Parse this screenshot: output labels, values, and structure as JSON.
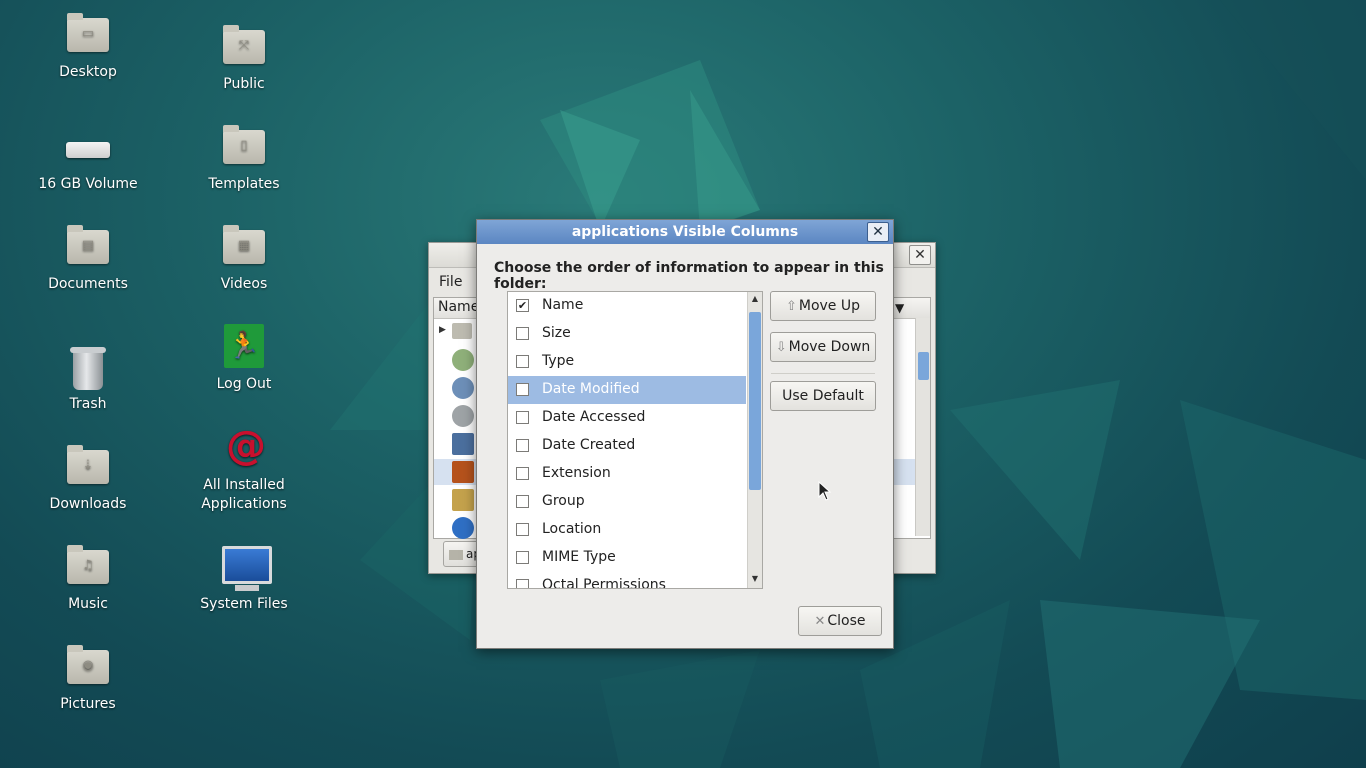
{
  "desktop": {
    "icons": [
      {
        "label": "Desktop",
        "icon": "folder-desktop-icon"
      },
      {
        "label": "Public",
        "icon": "folder-public-icon"
      },
      {
        "label": "16 GB Volume",
        "icon": "drive-icon"
      },
      {
        "label": "Templates",
        "icon": "folder-templates-icon"
      },
      {
        "label": "Documents",
        "icon": "folder-documents-icon"
      },
      {
        "label": "Videos",
        "icon": "folder-videos-icon"
      },
      {
        "label": "Trash",
        "icon": "trash-icon"
      },
      {
        "label": "Log Out",
        "icon": "log-out-icon"
      },
      {
        "label": "Downloads",
        "icon": "folder-downloads-icon"
      },
      {
        "label": "All Installed Applications",
        "icon": "debian-swirl-icon"
      },
      {
        "label": "Music",
        "icon": "folder-music-icon"
      },
      {
        "label": "System Files",
        "icon": "monitor-icon"
      },
      {
        "label": "Pictures",
        "icon": "folder-pictures-icon"
      }
    ],
    "accent": "#1c6266"
  },
  "background_window": {
    "menu_file": "File",
    "column_header": "Name",
    "path_button": "ap"
  },
  "dialog": {
    "title": "applications Visible Columns",
    "heading": "Choose the order of information to appear in this folder:",
    "columns": [
      {
        "label": "Name",
        "checked": true,
        "selected": false
      },
      {
        "label": "Size",
        "checked": false,
        "selected": false
      },
      {
        "label": "Type",
        "checked": false,
        "selected": false
      },
      {
        "label": "Date Modified",
        "checked": false,
        "selected": true
      },
      {
        "label": "Date Accessed",
        "checked": false,
        "selected": false
      },
      {
        "label": "Date Created",
        "checked": false,
        "selected": false
      },
      {
        "label": "Extension",
        "checked": false,
        "selected": false
      },
      {
        "label": "Group",
        "checked": false,
        "selected": false
      },
      {
        "label": "Location",
        "checked": false,
        "selected": false
      },
      {
        "label": "MIME Type",
        "checked": false,
        "selected": false
      },
      {
        "label": "Octal Permissions",
        "checked": false,
        "selected": false
      }
    ],
    "move_up_label": "Move Up",
    "move_down_label": "Move Down",
    "use_default_label": "Use Default",
    "close_label": "Close",
    "selection_color": "#9dbbe3"
  }
}
